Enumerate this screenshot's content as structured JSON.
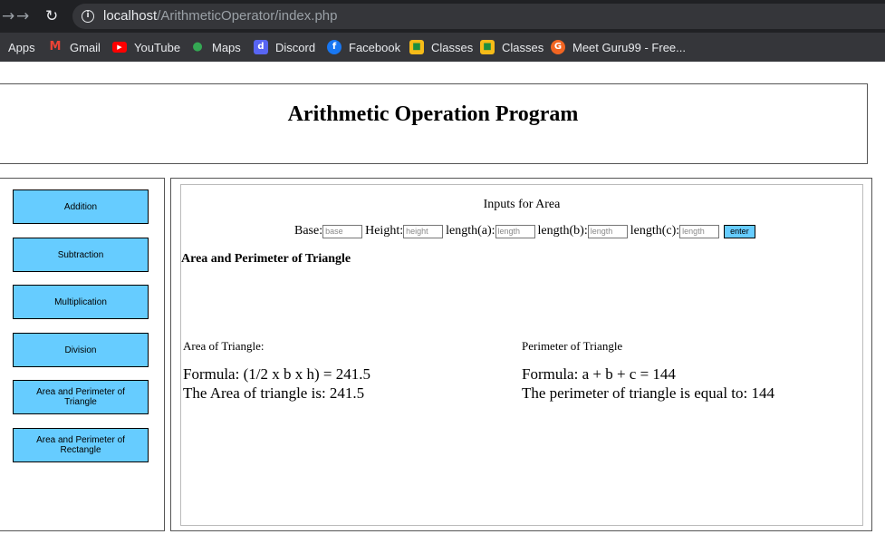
{
  "browser": {
    "url_host": "localhost",
    "url_path": "/ArithmeticOperator/index.php",
    "bookmarks": [
      {
        "label": "Apps",
        "icon": "apps-grid-icon"
      },
      {
        "label": "Gmail",
        "icon": "gmail-icon",
        "color": "#ea4335"
      },
      {
        "label": "YouTube",
        "icon": "youtube-icon",
        "color": "#ff0000"
      },
      {
        "label": "Maps",
        "icon": "maps-pin-icon",
        "color": "#34a853"
      },
      {
        "label": "Discord",
        "icon": "discord-icon",
        "color": "#5865f2"
      },
      {
        "label": "Facebook",
        "icon": "facebook-icon",
        "color": "#1877f2"
      },
      {
        "label": "Classes",
        "icon": "classroom-icon",
        "color": "#f6bb18"
      },
      {
        "label": "Classes",
        "icon": "classroom-icon",
        "color": "#f6bb18"
      },
      {
        "label": "Meet Guru99 - Free...",
        "icon": "guru99-icon",
        "color": "#f26522"
      }
    ]
  },
  "page": {
    "title": "Arithmetic Operation Program"
  },
  "sidebar": {
    "items": [
      {
        "label": "Addition"
      },
      {
        "label": "Subtraction"
      },
      {
        "label": "Multiplication"
      },
      {
        "label": "Division"
      },
      {
        "label": "Area and Perimeter of Triangle"
      },
      {
        "label": "Area and Perimeter of Rectangle"
      }
    ]
  },
  "form": {
    "title": "Inputs for Area",
    "base_label": "Base:",
    "base_placeholder": "base",
    "height_label": "Height:",
    "height_placeholder": "height",
    "length_a_label": "length(a):",
    "length_b_label": "length(b):",
    "length_c_label": "length(c):",
    "length_placeholder": "length",
    "enter_label": "enter"
  },
  "results": {
    "heading": "Area and Perimeter of Triangle",
    "area_label": "Area of Triangle:",
    "area_formula": "Formula: (1/2 x b x h) = 241.5",
    "area_result": "The Area of triangle is: 241.5",
    "perimeter_label": "Perimeter of Triangle",
    "perimeter_formula": "Formula: a + b + c = 144",
    "perimeter_result": "The perimeter of triangle is equal to: 144"
  },
  "colors": {
    "button_bg": "#66ccff",
    "chrome_dark": "#202124",
    "chrome_bar": "#35363a"
  }
}
